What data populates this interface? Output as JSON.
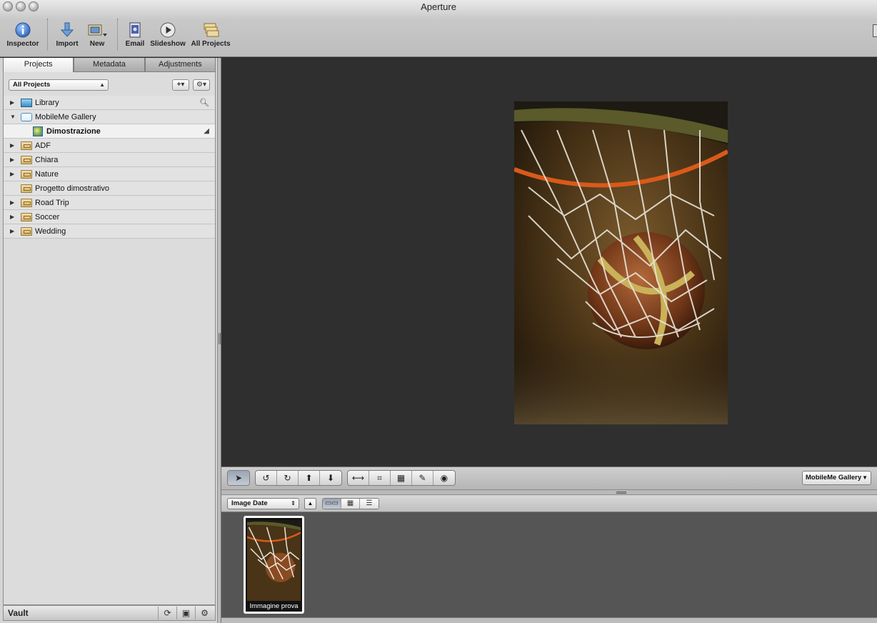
{
  "window": {
    "title": "Aperture"
  },
  "toolbar": {
    "items": [
      {
        "label": "Inspector",
        "icon": "info-icon"
      },
      {
        "label": "Import",
        "icon": "import-arrow-icon"
      },
      {
        "label": "New",
        "icon": "new-project-icon"
      },
      {
        "label": "Email",
        "icon": "email-icon"
      },
      {
        "label": "Slideshow",
        "icon": "play-icon"
      },
      {
        "label": "All Projects",
        "icon": "all-projects-icon"
      }
    ]
  },
  "panel": {
    "tabs": [
      {
        "label": "Projects",
        "active": true
      },
      {
        "label": "Metadata",
        "active": false
      },
      {
        "label": "Adjustments",
        "active": false
      }
    ],
    "filter_select": "All Projects",
    "tree": [
      {
        "label": "Library",
        "icon": "library-icon",
        "disclosure": "closed",
        "indent": 0
      },
      {
        "label": "MobileMe Gallery",
        "icon": "mobileme-cloud-icon",
        "disclosure": "open",
        "indent": 0
      },
      {
        "label": "Dimostrazione",
        "icon": "web-gallery-icon",
        "disclosure": "none",
        "indent": 1,
        "selected": true
      },
      {
        "label": "ADF",
        "icon": "project-folder-icon",
        "disclosure": "closed",
        "indent": 0
      },
      {
        "label": "Chiara",
        "icon": "project-folder-icon",
        "disclosure": "closed",
        "indent": 0
      },
      {
        "label": "Nature",
        "icon": "project-folder-icon",
        "disclosure": "closed",
        "indent": 0
      },
      {
        "label": "Progetto dimostrativo",
        "icon": "project-folder-icon",
        "disclosure": "none",
        "indent": 0
      },
      {
        "label": "Road Trip",
        "icon": "project-folder-icon",
        "disclosure": "closed",
        "indent": 0
      },
      {
        "label": "Soccer",
        "icon": "project-folder-icon",
        "disclosure": "closed",
        "indent": 0
      },
      {
        "label": "Wedding",
        "icon": "project-folder-icon",
        "disclosure": "closed",
        "indent": 0
      }
    ],
    "vault_label": "Vault"
  },
  "toolstrip": {
    "destination_select": "MobileMe Gallery"
  },
  "browser": {
    "sort_select": "Image Date",
    "thumbnails": [
      {
        "caption": "Immagine prova"
      }
    ]
  }
}
